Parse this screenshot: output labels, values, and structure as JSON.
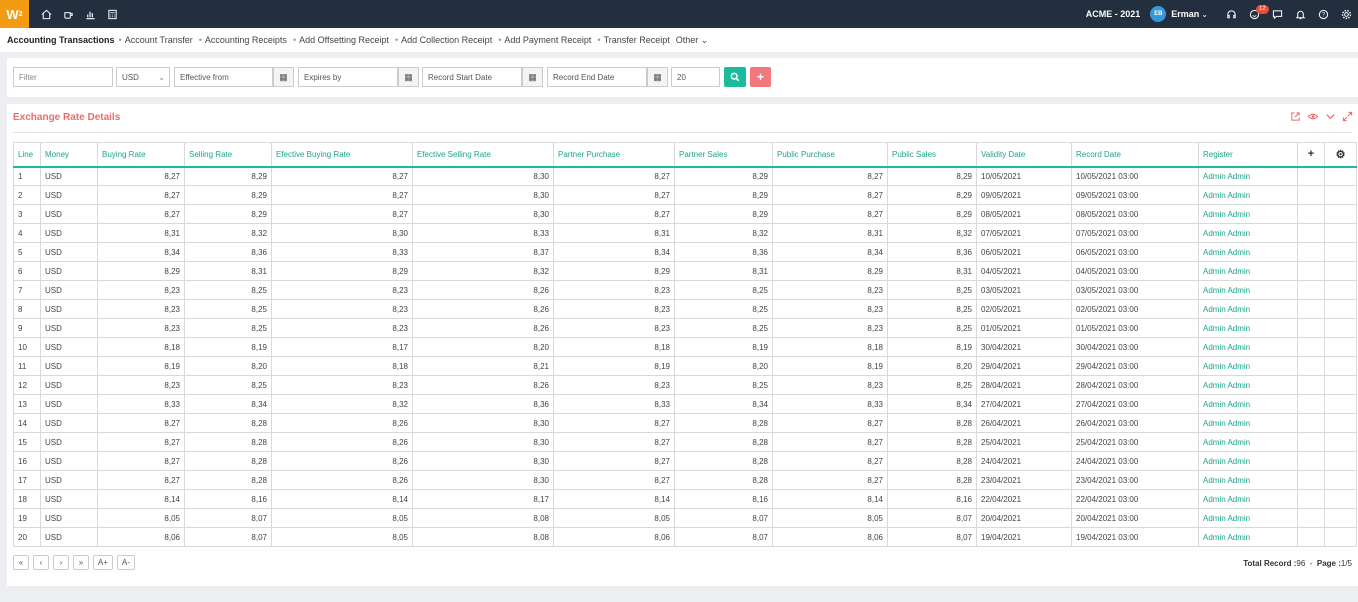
{
  "topbar": {
    "logo": "W",
    "logo_sup": "2",
    "nav_icons": [
      "home-icon",
      "coffee-icon",
      "bar-chart-icon",
      "calculator-icon"
    ],
    "company": "ACME - 2021",
    "user_initials": "EB",
    "user_name": "Erman",
    "notif_count": "12",
    "right_icons": [
      "headset-icon",
      "notification-icon",
      "chat-icon",
      "bell-icon",
      "help-icon",
      "settings-icon"
    ]
  },
  "nav": {
    "main": "Accounting Transactions",
    "items": [
      "Account Transfer",
      "Accounting Receipts",
      "Add Offsetting Receipt",
      "Add Collection Receipt",
      "Add Payment Receipt",
      "Transfer Receipt"
    ],
    "other": "Other"
  },
  "filters": {
    "filter_placeholder": "Filter",
    "currency": "USD",
    "effective_from": "Effective from",
    "expires_by": "Expires by",
    "record_start": "Record Start Date",
    "record_end": "Record End Date",
    "page_size": "20"
  },
  "panel": {
    "title": "Exchange Rate Details"
  },
  "table": {
    "columns": [
      "Line",
      "Money",
      "Buying Rate",
      "Selling Rate",
      "Efective Buying Rate",
      "Efective Selling Rate",
      "Partner Purchase",
      "Partner Sales",
      "Public Purchase",
      "Public Sales",
      "Validity Date",
      "Record Date",
      "Register",
      "+",
      "⚙"
    ],
    "rows": [
      [
        "1",
        "USD",
        "8,27",
        "8,29",
        "8,27",
        "8,30",
        "8,27",
        "8,29",
        "8,27",
        "8,29",
        "10/05/2021",
        "10/05/2021 03:00",
        "Admin Admin"
      ],
      [
        "2",
        "USD",
        "8,27",
        "8,29",
        "8,27",
        "8,30",
        "8,27",
        "8,29",
        "8,27",
        "8,29",
        "09/05/2021",
        "09/05/2021 03:00",
        "Admin Admin"
      ],
      [
        "3",
        "USD",
        "8,27",
        "8,29",
        "8,27",
        "8,30",
        "8,27",
        "8,29",
        "8,27",
        "8,29",
        "08/05/2021",
        "08/05/2021 03:00",
        "Admin Admin"
      ],
      [
        "4",
        "USD",
        "8,31",
        "8,32",
        "8,30",
        "8,33",
        "8,31",
        "8,32",
        "8,31",
        "8,32",
        "07/05/2021",
        "07/05/2021 03:00",
        "Admin Admin"
      ],
      [
        "5",
        "USD",
        "8,34",
        "8,36",
        "8,33",
        "8,37",
        "8,34",
        "8,36",
        "8,34",
        "8,36",
        "06/05/2021",
        "06/05/2021 03:00",
        "Admin Admin"
      ],
      [
        "6",
        "USD",
        "8,29",
        "8,31",
        "8,29",
        "8,32",
        "8,29",
        "8,31",
        "8,29",
        "8,31",
        "04/05/2021",
        "04/05/2021 03:00",
        "Admin Admin"
      ],
      [
        "7",
        "USD",
        "8,23",
        "8,25",
        "8,23",
        "8,26",
        "8,23",
        "8,25",
        "8,23",
        "8,25",
        "03/05/2021",
        "03/05/2021 03:00",
        "Admin Admin"
      ],
      [
        "8",
        "USD",
        "8,23",
        "8,25",
        "8,23",
        "8,26",
        "8,23",
        "8,25",
        "8,23",
        "8,25",
        "02/05/2021",
        "02/05/2021 03:00",
        "Admin Admin"
      ],
      [
        "9",
        "USD",
        "8,23",
        "8,25",
        "8,23",
        "8,26",
        "8,23",
        "8,25",
        "8,23",
        "8,25",
        "01/05/2021",
        "01/05/2021 03:00",
        "Admin Admin"
      ],
      [
        "10",
        "USD",
        "8,18",
        "8,19",
        "8,17",
        "8,20",
        "8,18",
        "8,19",
        "8,18",
        "8,19",
        "30/04/2021",
        "30/04/2021 03:00",
        "Admin Admin"
      ],
      [
        "11",
        "USD",
        "8,19",
        "8,20",
        "8,18",
        "8,21",
        "8,19",
        "8,20",
        "8,19",
        "8,20",
        "29/04/2021",
        "29/04/2021 03:00",
        "Admin Admin"
      ],
      [
        "12",
        "USD",
        "8,23",
        "8,25",
        "8,23",
        "8,26",
        "8,23",
        "8,25",
        "8,23",
        "8,25",
        "28/04/2021",
        "28/04/2021 03:00",
        "Admin Admin"
      ],
      [
        "13",
        "USD",
        "8,33",
        "8,34",
        "8,32",
        "8,36",
        "8,33",
        "8,34",
        "8,33",
        "8,34",
        "27/04/2021",
        "27/04/2021 03:00",
        "Admin Admin"
      ],
      [
        "14",
        "USD",
        "8,27",
        "8,28",
        "8,26",
        "8,30",
        "8,27",
        "8,28",
        "8,27",
        "8,28",
        "26/04/2021",
        "26/04/2021 03:00",
        "Admin Admin"
      ],
      [
        "15",
        "USD",
        "8,27",
        "8,28",
        "8,26",
        "8,30",
        "8,27",
        "8,28",
        "8,27",
        "8,28",
        "25/04/2021",
        "25/04/2021 03:00",
        "Admin Admin"
      ],
      [
        "16",
        "USD",
        "8,27",
        "8,28",
        "8,26",
        "8,30",
        "8,27",
        "8,28",
        "8,27",
        "8,28",
        "24/04/2021",
        "24/04/2021 03:00",
        "Admin Admin"
      ],
      [
        "17",
        "USD",
        "8,27",
        "8,28",
        "8,26",
        "8,30",
        "8,27",
        "8,28",
        "8,27",
        "8,28",
        "23/04/2021",
        "23/04/2021 03:00",
        "Admin Admin"
      ],
      [
        "18",
        "USD",
        "8,14",
        "8,16",
        "8,14",
        "8,17",
        "8,14",
        "8,16",
        "8,14",
        "8,16",
        "22/04/2021",
        "22/04/2021 03:00",
        "Admin Admin"
      ],
      [
        "19",
        "USD",
        "8,05",
        "8,07",
        "8,05",
        "8,08",
        "8,05",
        "8,07",
        "8,05",
        "8,07",
        "20/04/2021",
        "20/04/2021 03:00",
        "Admin Admin"
      ],
      [
        "20",
        "USD",
        "8,06",
        "8,07",
        "8,05",
        "8,08",
        "8,06",
        "8,07",
        "8,06",
        "8,07",
        "19/04/2021",
        "19/04/2021 03:00",
        "Admin Admin"
      ]
    ]
  },
  "pager": {
    "first": "«",
    "prev": "‹",
    "next": "›",
    "last": "»",
    "font_up": "A+",
    "font_down": "A-",
    "total_label": "Total Record :",
    "total_value": "96",
    "page_label": "Page :",
    "page_value": "1/5"
  }
}
